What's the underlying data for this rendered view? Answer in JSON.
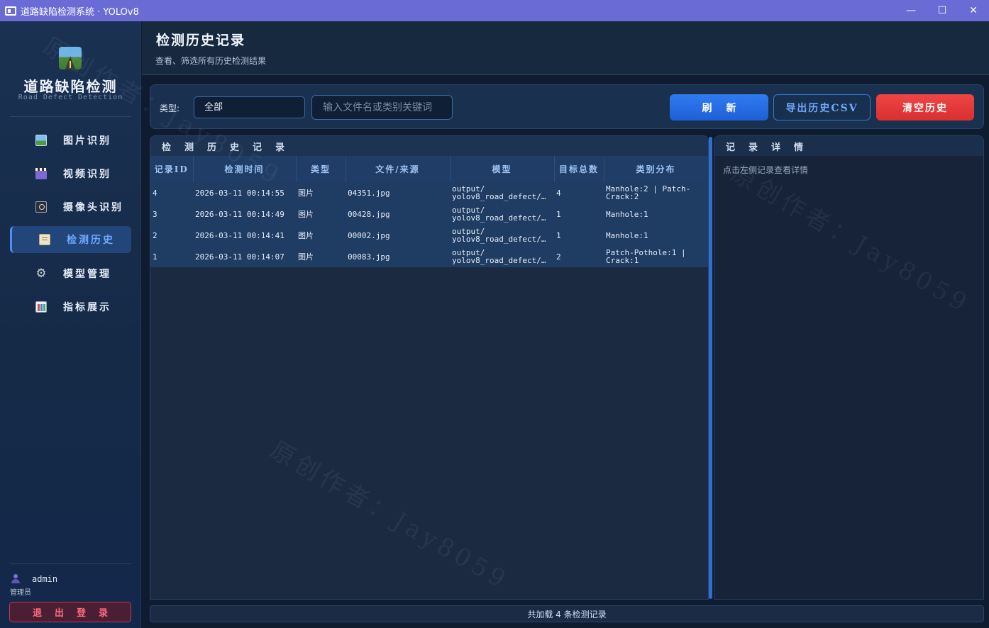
{
  "window": {
    "title": "道路缺陷检测系统 · YOLOv8",
    "controls": [
      "—",
      "☐",
      "✕"
    ]
  },
  "sidebar": {
    "brand": "道路缺陷检测",
    "brand_sub": "Road Defect Detection",
    "items": [
      {
        "label": "图片识别",
        "icon": "image-icon"
      },
      {
        "label": "视频识别",
        "icon": "video-icon"
      },
      {
        "label": "摄像头识别",
        "icon": "camera-icon"
      },
      {
        "label": "检测历史",
        "icon": "clipboard-icon",
        "active": true
      },
      {
        "label": "模型管理",
        "icon": "gear-icon"
      },
      {
        "label": "指标展示",
        "icon": "chart-icon"
      }
    ],
    "user": {
      "name": "admin",
      "role": "管理员"
    },
    "logout_label": "退出登录"
  },
  "header": {
    "title": "检测历史记录",
    "subtitle": "查看、筛选所有历史检测结果"
  },
  "filter": {
    "type_label": "类型:",
    "type_value": "全部",
    "search_placeholder": "输入文件名或类别关键词",
    "refresh_label": "刷新",
    "export_label": "导出历史CSV",
    "clear_label": "清空历史"
  },
  "table": {
    "panel_title": "检测历史记录",
    "columns": [
      "记录ID",
      "检测时间",
      "类型",
      "文件/来源",
      "模型",
      "目标总数",
      "类别分布"
    ],
    "rows": [
      {
        "id": "4",
        "time": "2026-03-11 00:14:55",
        "type": "图片",
        "file": "04351.jpg",
        "model": "output/\nyolov8_road_defect/…",
        "count": "4",
        "dist": "Manhole:2 | Patch-\nCrack:2"
      },
      {
        "id": "3",
        "time": "2026-03-11 00:14:49",
        "type": "图片",
        "file": "00428.jpg",
        "model": "output/\nyolov8_road_defect/…",
        "count": "1",
        "dist": "Manhole:1"
      },
      {
        "id": "2",
        "time": "2026-03-11 00:14:41",
        "type": "图片",
        "file": "00002.jpg",
        "model": "output/\nyolov8_road_defect/…",
        "count": "1",
        "dist": "Manhole:1"
      },
      {
        "id": "1",
        "time": "2026-03-11 00:14:07",
        "type": "图片",
        "file": "00083.jpg",
        "model": "output/\nyolov8_road_defect/…",
        "count": "2",
        "dist": "Patch-Pothole:1 |\nCrack:1"
      }
    ]
  },
  "detail": {
    "panel_title": "记录详情",
    "hint": "点击左侧记录查看详情"
  },
  "status": "共加载 4 条检测记录",
  "watermark": "原创作者：Jay8059",
  "colors": {
    "accent": "#2f7bf0",
    "danger": "#e23a3a",
    "sidebar_bg": "#1a3152",
    "titlebar": "#6b6bd6"
  }
}
